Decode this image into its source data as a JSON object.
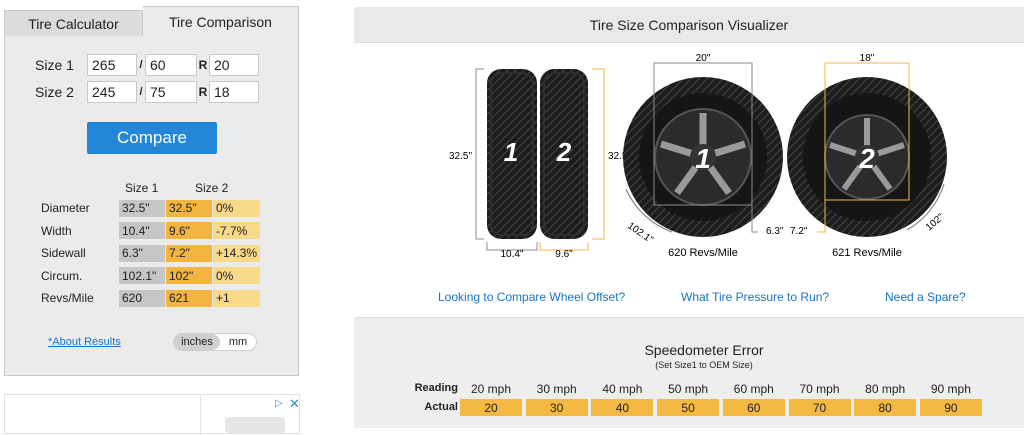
{
  "tabs": {
    "calculator": "Tire Calculator",
    "comparison": "Tire Comparison"
  },
  "inputs": {
    "size1_label": "Size 1",
    "size2_label": "Size 2",
    "slash": "/",
    "r": "R",
    "size1": {
      "width": "265",
      "aspect": "60",
      "rim": "20"
    },
    "size2": {
      "width": "245",
      "aspect": "75",
      "rim": "18"
    }
  },
  "compare_label": "Compare",
  "results": {
    "head1": "Size 1",
    "head2": "Size 2",
    "rows": [
      {
        "label": "Diameter",
        "s1": "32.5\"",
        "s2": "32.5\"",
        "diff": "0%"
      },
      {
        "label": "Width",
        "s1": "10.4\"",
        "s2": "9.6\"",
        "diff": "-7.7%"
      },
      {
        "label": "Sidewall",
        "s1": "6.3\"",
        "s2": "7.2\"",
        "diff": "+14.3%"
      },
      {
        "label": "Circum.",
        "s1": "102.1\"",
        "s2": "102\"",
        "diff": "0%"
      },
      {
        "label": "Revs/Mile",
        "s1": "620",
        "s2": "621",
        "diff": "+1"
      }
    ]
  },
  "about_label": "*About Results",
  "units": {
    "inches": "inches",
    "mm": "mm"
  },
  "ad": {
    "choices_icon": "ad-choices-icon",
    "close": "✕"
  },
  "visualizer": {
    "title": "Tire Size Comparison Visualizer",
    "tire1_label": "1",
    "tire2_label": "2",
    "left_height": "32.5\"",
    "right_height": "32.5\"",
    "width1": "10.4\"",
    "width2": "9.6\"",
    "rim1": "20\"",
    "rim2": "18\"",
    "sidewall1": "6.3\"",
    "sidewall2": "7.2\"",
    "circ1": "102.1\"",
    "circ2": "102\"",
    "revs1": "620 Revs/Mile",
    "revs2": "621 Revs/Mile",
    "colors": {
      "tire": "#1b1b1b",
      "rim": "#2a2a2a",
      "dim": "#f3b53f",
      "guide": "#888888"
    }
  },
  "links": {
    "offset": "Looking to Compare Wheel Offset?",
    "pressure": "What Tire Pressure to Run?",
    "spare": "Need a Spare?"
  },
  "speedo": {
    "title": "Speedometer Error",
    "subtitle": "(Set Size1 to OEM Size)",
    "reading_label": "Reading",
    "actual_label": "Actual",
    "readings": [
      "20 mph",
      "30 mph",
      "40 mph",
      "50 mph",
      "60 mph",
      "70 mph",
      "80 mph",
      "90 mph"
    ],
    "actuals": [
      "20",
      "30",
      "40",
      "50",
      "60",
      "70",
      "80",
      "90"
    ]
  }
}
